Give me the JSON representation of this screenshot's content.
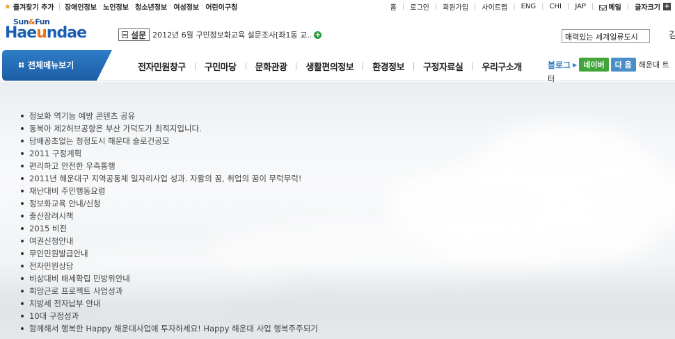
{
  "topbar": {
    "bookmark": "즐겨찾기 추가",
    "links": [
      "장애인정보",
      "노인정보",
      "청소년정보",
      "여성정보",
      "어린이구청"
    ],
    "right": [
      "홈",
      "로그인",
      "회원가입",
      "사이트맵",
      "ENG",
      "CHI",
      "JAP"
    ],
    "mail": "메일",
    "fontsize": "글자크기"
  },
  "logo": {
    "line1a": "Sun",
    "line1b": "&",
    "line1c": "Fun",
    "line2a": "Hae",
    "line2b": "u",
    "line2c": "ndae"
  },
  "survey": {
    "tag": "설문",
    "text": "2012년 6월 구민정보화교육 설문조사[좌1동 교.."
  },
  "slogan": {
    "value": "매력있는 세계일류도시",
    "right": "김"
  },
  "nav": {
    "allmenu": "전체메뉴보기",
    "items": [
      "전자민원창구",
      "구민마당",
      "문화관광",
      "생활편의정보",
      "환경정보",
      "구정자료실",
      "우리구소개"
    ],
    "blog": "블로그",
    "naver": "네이버",
    "daum": "다 음",
    "blog_title": "해운대 트",
    "blog_tail": "터"
  },
  "list": [
    "정보화 역기능 예방 콘텐츠 공유",
    "동북아 제2허브공항은 부산 가덕도가 최적지입니다.",
    "담배꽁초없는 청정도시 해운대 슬로건공모",
    "2011 구정계획",
    "편리하고 안전한 우측통행",
    "2011년 해운대구 지역공동체 일자리사업 성과. 자활의 꿈, 취업의 꿈이 무럭무럭!",
    "재난대비 주민행동요령",
    "정보화교육 안내/신청",
    "출산장려시책",
    "2015 비전",
    "여권신청안내",
    "무인민원발급안내",
    "전자민원상담",
    "비상대비 태세확립 민방위안내",
    "희망근로 프로젝트 사업성과",
    "지방세 전자납부 안내",
    "10대 구정성과",
    "함께해서 행복한 Happy 해운대사업에 투자하세요! Happy 해운대 사업 행복주주되기"
  ],
  "colors": {
    "brand_blue": "#1a5fb4",
    "accent_orange": "#e8731a",
    "naver_green": "#41a53a",
    "daum_blue": "#4a8fc8"
  }
}
